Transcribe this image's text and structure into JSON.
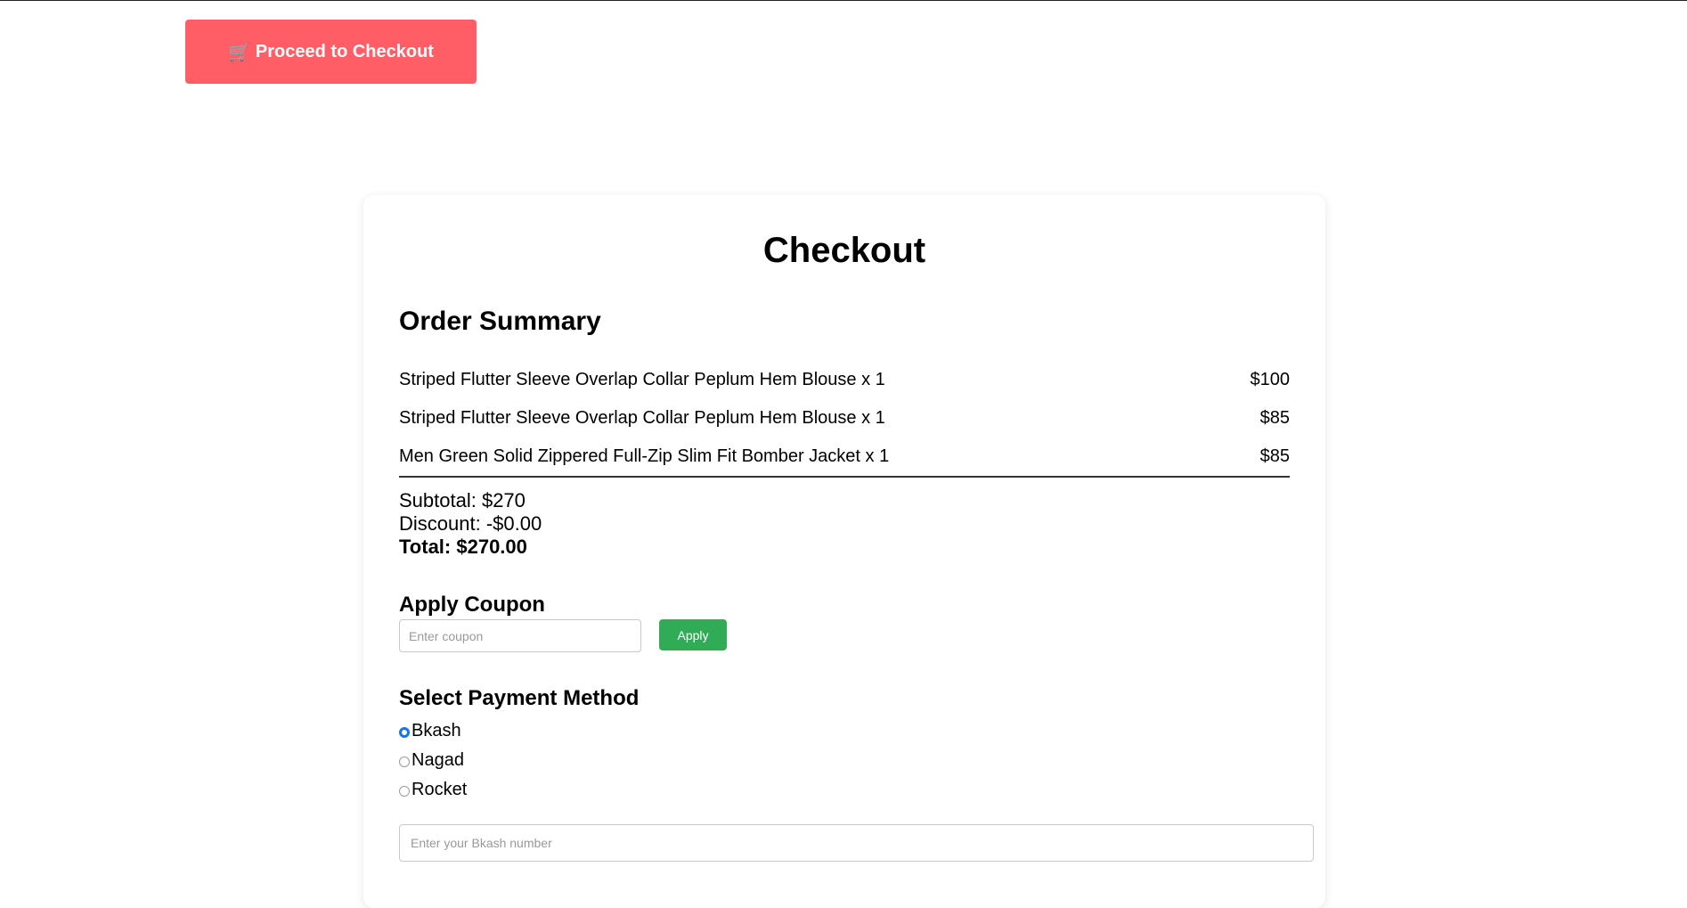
{
  "header": {
    "proceed_label": "Proceed to Checkout",
    "proceed_icon": "🛒"
  },
  "checkout": {
    "title": "Checkout",
    "order_summary_title": "Order Summary",
    "items": [
      {
        "name": "Striped Flutter Sleeve Overlap Collar Peplum Hem Blouse x 1",
        "price": "$100"
      },
      {
        "name": "Striped Flutter Sleeve Overlap Collar Peplum Hem Blouse x 1",
        "price": "$85"
      },
      {
        "name": "Men Green Solid Zippered Full-Zip Slim Fit Bomber Jacket x 1",
        "price": "$85"
      }
    ],
    "subtotal": "Subtotal: $270",
    "discount": "Discount: -$0.00",
    "total": "Total: $270.00"
  },
  "coupon": {
    "title": "Apply Coupon",
    "placeholder": "Enter coupon",
    "apply_label": "Apply"
  },
  "payment": {
    "title": "Select Payment Method",
    "options": [
      {
        "label": "Bkash",
        "selected": true
      },
      {
        "label": "Nagad",
        "selected": false
      },
      {
        "label": "Rocket",
        "selected": false
      }
    ],
    "number_placeholder": "Enter your Bkash number"
  },
  "colors": {
    "proceed_button": "#ff5e66",
    "apply_button": "#2fac55",
    "radio_selected": "#1a73e8"
  }
}
